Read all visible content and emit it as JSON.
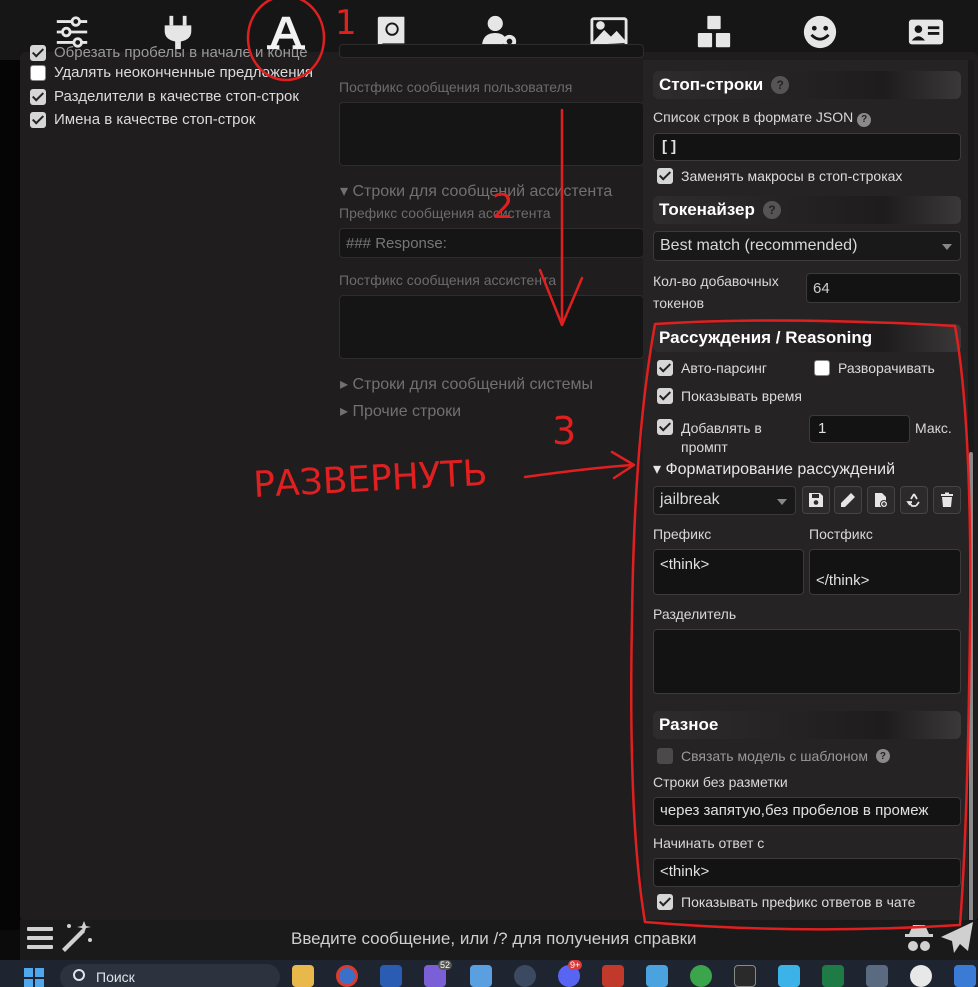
{
  "topbar": {
    "icons": [
      "sliders-icon",
      "plug-icon",
      "font-icon",
      "book-icon",
      "user-gear-icon",
      "image-icon",
      "cubes-icon",
      "smiley-icon",
      "id-card-icon"
    ]
  },
  "left": {
    "cut_text": "Обрезать пробелы в начале и конце",
    "options": [
      {
        "label": "Удалять неоконченные предложения",
        "checked": false
      },
      {
        "label": "Разделители в качестве стоп-строк",
        "checked": true
      },
      {
        "label": "Имена в качестве стоп-строк",
        "checked": true
      }
    ]
  },
  "middle": {
    "user_postfix_label": "Постфикс сообщения пользователя",
    "assistant_section": "Строки для сообщений ассистента",
    "assistant_prefix_label": "Префикс сообщения ассистента",
    "assistant_prefix_value": "### Response:",
    "assistant_postfix_label": "Постфикс сообщения ассистента",
    "system_section": "Строки для сообщений системы",
    "other_section": "Прочие строки"
  },
  "stop": {
    "title": "Стоп-строки",
    "json_label": "Список строк в формате JSON",
    "json_value": "[ ]",
    "replace_macros": "Заменять макросы в стоп-строках"
  },
  "tokenizer": {
    "title": "Токенайзер",
    "selected": "Best match (recommended)",
    "extra_label_1": "Кол-во добавочных",
    "extra_label_2": "токенов",
    "extra_value": "64"
  },
  "reasoning": {
    "title": "Рассуждения / Reasoning",
    "auto_parse": "Авто-парсинг",
    "expand": "Разворачивать",
    "show_time": "Показывать время",
    "add_prompt_1": "Добавлять в",
    "add_prompt_2": "промпт",
    "max_value": "1",
    "max_label": "Макс.",
    "format_section": "Форматирование рассуждений",
    "preset": "jailbreak",
    "prefix_label": "Префикс",
    "postfix_label": "Постфикс",
    "prefix_value": "<think>",
    "postfix_value": "</think>",
    "separator_label": "Разделитель"
  },
  "misc": {
    "title": "Разное",
    "bind_model": "Связать модель с шаблоном",
    "no_markup_label": "Строки без разметки",
    "no_markup_value": "через запятую,без пробелов в промеж",
    "start_reply_label": "Начинать ответ с",
    "start_reply_value": "<think>",
    "show_prefix": "Показывать префикс ответов в чате"
  },
  "bottom": {
    "hint": "Введите сообщение, или /? для получения справки"
  },
  "taskbar": {
    "search": "Поиск",
    "badge_1": "52",
    "badge_2": "9+"
  },
  "annotations": {
    "n1": "1",
    "n2": "2",
    "n3": "3",
    "word": "РАЗВЕРНУТЬ"
  }
}
